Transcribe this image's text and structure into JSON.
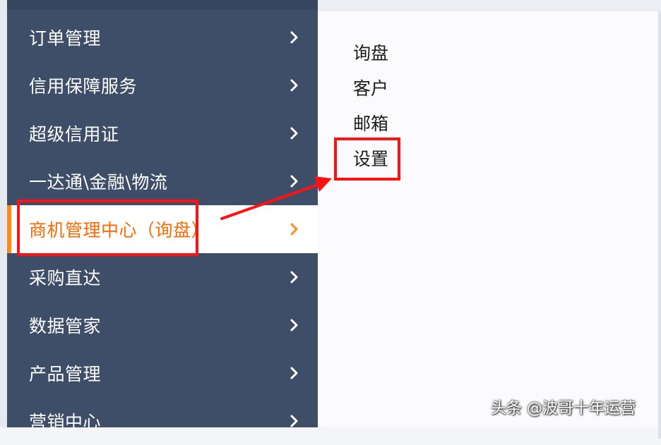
{
  "sidebar": {
    "items": [
      {
        "label": "订单管理"
      },
      {
        "label": "信用保障服务"
      },
      {
        "label": "超级信用证"
      },
      {
        "label": "一达通\\金融\\物流"
      },
      {
        "label": "商机管理中心（询盘）",
        "active": true
      },
      {
        "label": "采购直达"
      },
      {
        "label": "数据管家"
      },
      {
        "label": "产品管理"
      },
      {
        "label": "营销中心"
      }
    ],
    "chevron_icon": "chevron-right-icon",
    "colors": {
      "background": "#3e4e69",
      "active_text": "#ff6a00",
      "accent": "#ff8a1c"
    }
  },
  "submenu": {
    "items": [
      {
        "label": "询盘"
      },
      {
        "label": "客户"
      },
      {
        "label": "邮箱"
      },
      {
        "label": "设置",
        "highlighted": true
      }
    ]
  },
  "annotation": {
    "color": "#ff1111"
  },
  "watermark": "头条 @波哥十年运营"
}
